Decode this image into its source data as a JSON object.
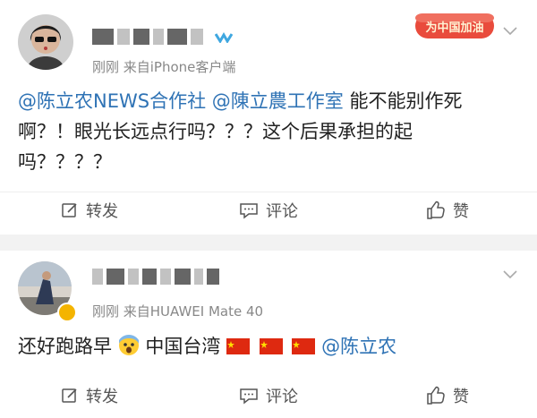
{
  "posts": [
    {
      "meta": "刚刚 来自iPhone客户端",
      "tag_text": "为中国加油",
      "content": {
        "mention1": "@陈立农NEWS合作社",
        "mention2": "@陳立農工作室",
        "line1_rest": "能不能别作死",
        "line2": "啊？！眼光长远点行吗？？？这个后果承担的起",
        "line3": "吗？？？？"
      },
      "actions": {
        "repost": "转发",
        "comment": "评论",
        "like": "赞"
      }
    },
    {
      "meta": "刚刚 来自HUAWEI Mate 40",
      "content": {
        "text1": "还好跑路早",
        "text2": "中国台湾",
        "mention": "@陈立农"
      },
      "actions": {
        "repost": "转发",
        "comment": "评论",
        "like": "赞"
      }
    }
  ],
  "icons": {
    "repost": "edit-repost-icon",
    "comment": "comment-icon",
    "like": "thumbs-up-icon",
    "more": "chevron-down-icon",
    "emoji": "fearful-face-emoji",
    "flag": "china-flag-emoji"
  },
  "colors": {
    "link": "#2f73b5",
    "meta": "#888888",
    "separator": "#f2f2f2"
  }
}
